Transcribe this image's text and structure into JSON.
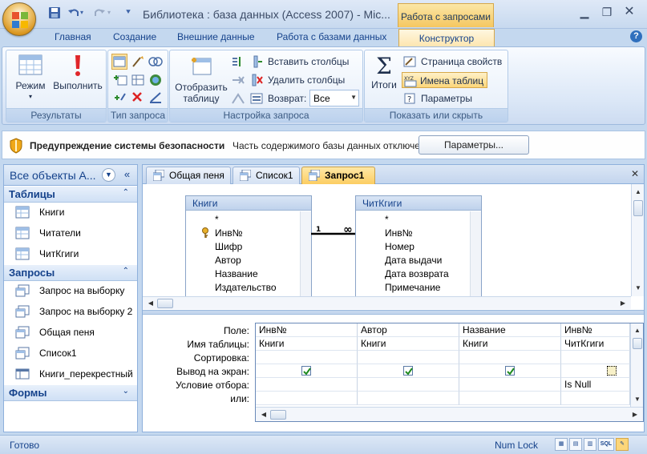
{
  "title": "Библиотека : база данных (Access 2007)  -  Mic...",
  "context_tab": "Работа с запросами",
  "tabs": [
    "Главная",
    "Создание",
    "Внешние данные",
    "Работа с базами данных",
    "Конструктор"
  ],
  "ribbon": {
    "results": {
      "label": "Результаты",
      "mode": "Режим",
      "run": "Выполнить"
    },
    "query_type": {
      "label": "Тип запроса"
    },
    "setup": {
      "label": "Настройка запроса",
      "show_table_line1": "Отобразить",
      "show_table_line2": "таблицу",
      "insert_cols": "Вставить столбцы",
      "delete_cols": "Удалить столбцы",
      "return_label": "Возврат:",
      "return_value": "Все"
    },
    "show_hide": {
      "label": "Показать или скрыть",
      "totals": "Итоги",
      "property_sheet": "Страница свойств",
      "table_names": "Имена таблиц",
      "parameters": "Параметры"
    }
  },
  "security": {
    "title": "Предупреждение системы безопасности",
    "message": "Часть содержимого базы данных отключено",
    "button": "Параметры..."
  },
  "nav": {
    "title": "Все объекты A...",
    "groups": {
      "tables": {
        "label": "Таблицы",
        "items": [
          "Книги",
          "Читатели",
          "ЧитКгиги"
        ]
      },
      "queries": {
        "label": "Запросы",
        "items": [
          "Запрос на выборку",
          "Запрос на выборку 2",
          "Общая пеня",
          "Список1",
          "Книги_перекрестный"
        ]
      },
      "forms": {
        "label": "Формы"
      }
    }
  },
  "doc_tabs": [
    "Общая пеня",
    "Список1",
    "Запрос1"
  ],
  "diagram": {
    "table1": {
      "name": "Книги",
      "fields": [
        "*",
        "Инв№",
        "Шифр",
        "Автор",
        "Название",
        "Издательство"
      ]
    },
    "table2": {
      "name": "ЧитКгиги",
      "fields": [
        "*",
        "Инв№",
        "Номер",
        "Дата выдачи",
        "Дата возврата",
        "Примечание"
      ]
    },
    "relation_one": "1",
    "relation_many": "∞"
  },
  "grid": {
    "row_labels": [
      "Поле:",
      "Имя таблицы:",
      "Сортировка:",
      "Вывод на экран:",
      "Условие отбора:",
      "или:"
    ],
    "columns": [
      {
        "field": "Инв№",
        "table": "Книги",
        "show": true,
        "criteria": ""
      },
      {
        "field": "Автор",
        "table": "Книги",
        "show": true,
        "criteria": ""
      },
      {
        "field": "Название",
        "table": "Книги",
        "show": true,
        "criteria": ""
      },
      {
        "field": "Инв№",
        "table": "ЧитКгиги",
        "show": false,
        "criteria": "Is Null"
      }
    ]
  },
  "status": {
    "text": "Готово",
    "numlock": "Num Lock",
    "sql": "SQL"
  }
}
